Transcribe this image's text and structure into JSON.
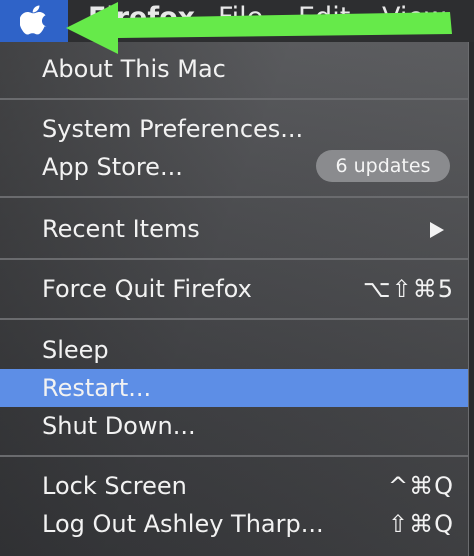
{
  "menubar": {
    "apple_icon": "apple-logo-icon",
    "items": [
      "Firefox",
      "File",
      "Edit",
      "View"
    ],
    "highlight_color": "#2f63c8"
  },
  "menu": {
    "about": "About This Mac",
    "system_preferences": "System Preferences...",
    "app_store": "App Store...",
    "app_store_badge": "6 updates",
    "recent_items": "Recent Items",
    "recent_items_icon": "submenu-arrow-icon",
    "force_quit": "Force Quit Firefox",
    "force_quit_shortcut": "⌥⇧⌘5",
    "sleep": "Sleep",
    "restart": "Restart...",
    "shut_down": "Shut Down...",
    "lock_screen": "Lock Screen",
    "lock_screen_shortcut": "^⌘Q",
    "log_out": "Log Out Ashley Tharp...",
    "log_out_shortcut": "⇧⌘Q",
    "highlighted_item": "Restart...",
    "highlight_color": "#5d8ee6"
  },
  "annotation": {
    "arrow_color": "#66ea4a",
    "arrow_icon": "pointer-arrow-icon"
  }
}
